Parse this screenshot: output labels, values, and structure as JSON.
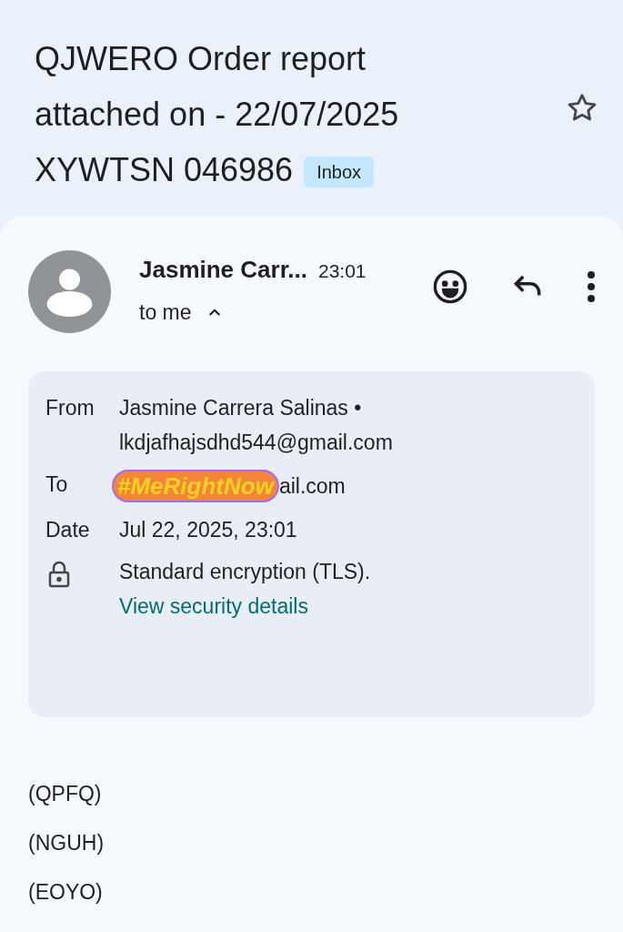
{
  "subject": {
    "lines": [
      "QJWERO Order report",
      "attached on - 22/07/2025",
      "XYWTSN 046986"
    ],
    "label": "Inbox",
    "starred": false
  },
  "message": {
    "sender": "Jasmine Carr...",
    "time": "23:01",
    "recipient": "to me",
    "expanded": true
  },
  "details": {
    "rows": [
      {
        "kind": "field",
        "label": "From",
        "lines": [
          "Jasmine Carrera Salinas •",
          "lkdjafhajsdhd544@gmail.com"
        ]
      },
      {
        "kind": "covered",
        "label": "To",
        "sticker": "#MeRightNow",
        "lines": [
          "ail.com"
        ]
      },
      {
        "kind": "field",
        "label": "Date",
        "lines": [
          "Jul 22, 2025, 23:01"
        ]
      },
      {
        "kind": "security",
        "lines": [
          "Standard encryption (TLS)."
        ],
        "link": "View security details"
      }
    ]
  },
  "body": [
    "(QPFQ)",
    "(NGUH)",
    "(EOYO)"
  ]
}
